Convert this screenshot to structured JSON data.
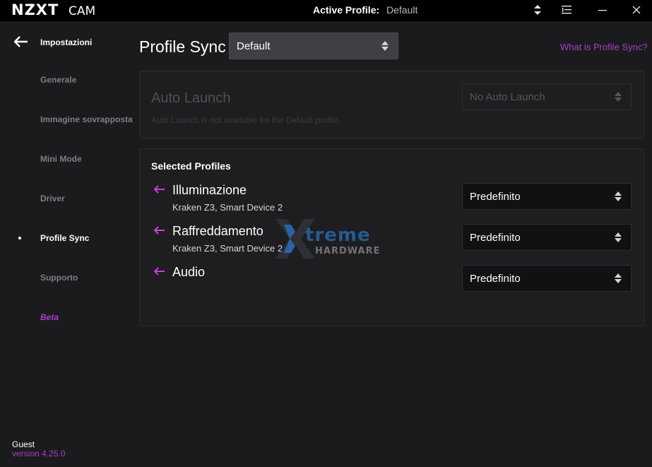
{
  "titlebar": {
    "logo_bold": "NZXT",
    "logo_cam": "CAM",
    "active_profile_label": "Active Profile:",
    "active_profile_value": "Default",
    "icons": [
      "profile-switch-icon",
      "menu-icon",
      "minimize-icon",
      "close-icon"
    ]
  },
  "sidebar": {
    "header": "Impostazioni",
    "items": [
      {
        "label": "Generale",
        "active": false
      },
      {
        "label": "Immagine sovrapposta",
        "active": false
      },
      {
        "label": "Mini Mode",
        "active": false
      },
      {
        "label": "Driver",
        "active": false
      },
      {
        "label": "Profile Sync",
        "active": true
      },
      {
        "label": "Supporto",
        "active": false
      },
      {
        "label": "Beta",
        "active": false
      }
    ],
    "user": "Guest",
    "version": "version 4.25.0"
  },
  "main": {
    "title": "Profile Sync",
    "profile_select": "Default",
    "help_link": "What is Profile Sync?",
    "auto_launch": {
      "title": "Auto Launch",
      "subtitle": "Auto Launch is not available for the Default profile.",
      "select_value": "No Auto Launch"
    },
    "selected_profiles": {
      "title": "Selected Profiles",
      "rows": [
        {
          "name": "Illuminazione",
          "devices": "Kraken Z3, Smart Device 2",
          "value": "Predefinito"
        },
        {
          "name": "Raffreddamento",
          "devices": "Kraken Z3, Smart Device 2",
          "value": "Predefinito"
        },
        {
          "name": "Audio",
          "devices": "",
          "value": "Predefinito"
        }
      ]
    }
  },
  "watermark": {
    "line1": "treme",
    "line2": "HARDWARE"
  },
  "colors": {
    "accent": "#a83fc6",
    "arrow": "#c142d6",
    "background": "#1b1b1e",
    "titlebar": "#000000"
  }
}
